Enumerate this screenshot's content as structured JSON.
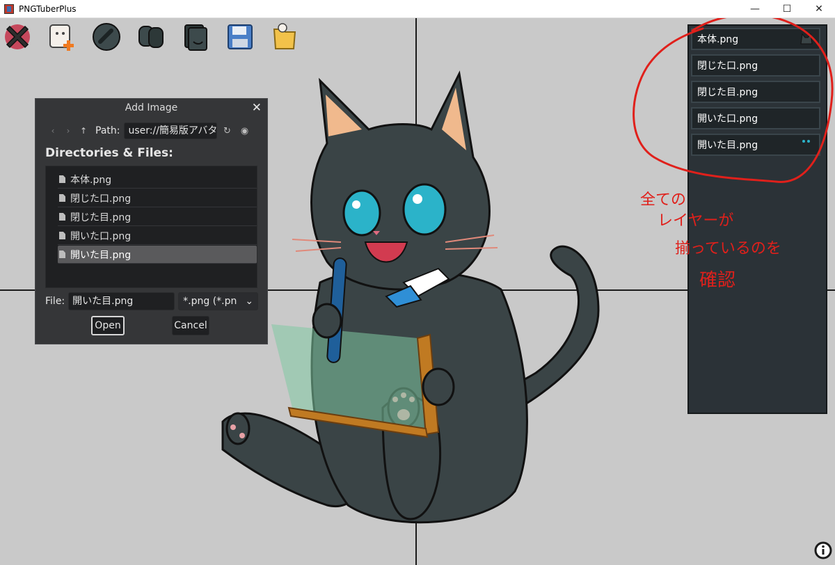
{
  "window": {
    "title": "PNGTuberPlus",
    "minimize": "—",
    "maximize": "☐",
    "close": "✕"
  },
  "toolbar": {
    "items": [
      {
        "name": "exit",
        "icon": "red-x-icon"
      },
      {
        "name": "add-image",
        "icon": "add-sprite-icon"
      },
      {
        "name": "link",
        "icon": "link-icon"
      },
      {
        "name": "costumes",
        "icon": "masks-icon"
      },
      {
        "name": "layers",
        "icon": "sprite-stack-icon"
      },
      {
        "name": "save",
        "icon": "floppy-disk-icon"
      },
      {
        "name": "load",
        "icon": "folder-icon"
      }
    ]
  },
  "dialog": {
    "title": "Add Image",
    "close": "✕",
    "nav": {
      "back": "‹",
      "forward": "›",
      "up": "↑"
    },
    "path_label": "Path:",
    "path_value": "user://簡易版アバタ",
    "refresh": "↻",
    "toggle_hidden": "◉",
    "dir_label": "Directories & Files:",
    "files": [
      "本体.png",
      "閉じた口.png",
      "閉じた目.png",
      "開いた口.png",
      "開いた目.png"
    ],
    "selected_index": 4,
    "file_label": "File:",
    "file_value": "開いた目.png",
    "filter_value": "*.png (*.pn",
    "filter_arrow": "⌄",
    "open_label": "Open",
    "cancel_label": "Cancel"
  },
  "layers": {
    "items": [
      "本体.png",
      "閉じた口.png",
      "閉じた目.png",
      "開いた口.png",
      "開いた目.png"
    ]
  },
  "annotation": {
    "text_lines": [
      "全ての",
      "レイヤーが",
      "揃っているのを",
      "確認"
    ],
    "color": "#e0201b"
  },
  "colors": {
    "viewport": "#c9c9c9",
    "dialog_bg": "#353638",
    "panel_bg": "#2b3237",
    "guide": "#1b1b1b"
  }
}
